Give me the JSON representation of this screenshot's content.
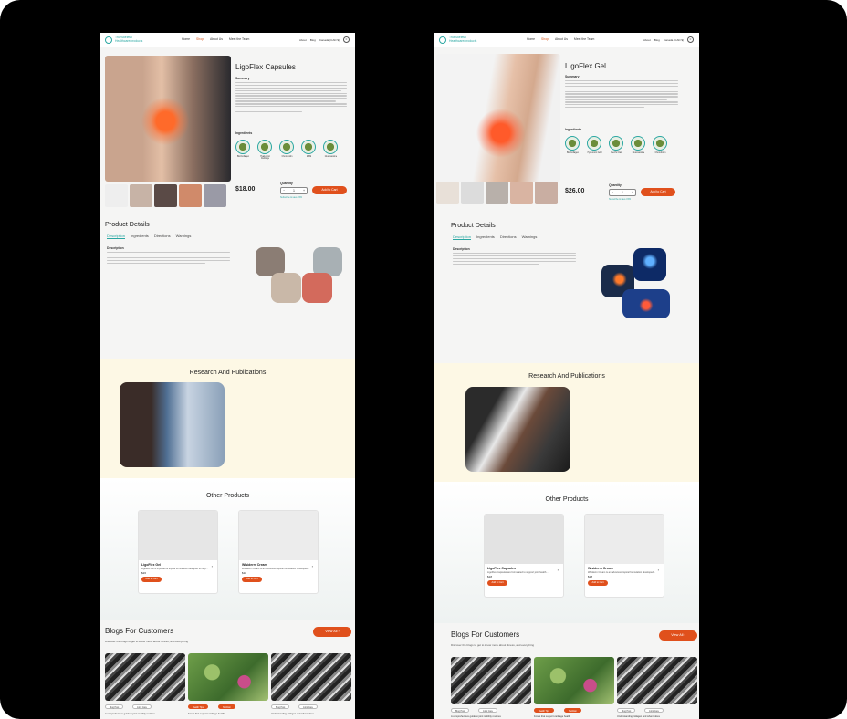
{
  "brand": {
    "name": "TrueSkeletal Healthcare/products"
  },
  "nav": {
    "links": [
      "Home",
      "Shop",
      "About Us",
      "Meet the Team"
    ],
    "right": [
      "About",
      "Blog",
      "Canada (CAD $)"
    ],
    "cart_count": "0"
  },
  "page_a": {
    "title": "LigoFlex Capsules",
    "summary_label": "Summary",
    "ingredients_label": "Ingredients",
    "ingredients": [
      "Bio/Collagen",
      "Hyaluronic Cartilage",
      "Chondroitin",
      "MSM",
      "Glucosamine"
    ],
    "price": "$18.00",
    "quantity_label": "Quantity",
    "quantity": "1",
    "add_to_cart": "Add to Cart",
    "subscribe_note": "Subscribe & save 15%",
    "details_title": "Product Details",
    "tabs": [
      "Description",
      "Ingredients",
      "Directions",
      "Warnings"
    ],
    "description_label": "Description",
    "research_title": "Research And Publications",
    "others_title": "Other Products",
    "others": [
      {
        "name": "LigoFlex Gel",
        "desc": "Ligoflex Gel is a powerful topical formulation designed to help...",
        "price": "$26",
        "cta": "Add to Cart"
      },
      {
        "name": "Wisiderm Cream",
        "desc": "Wisiderm Cream is an advanced topical formulation developed...",
        "price": "$18",
        "cta": "Add to Cart"
      }
    ],
    "blogs_title": "Blogs For Customers",
    "blogs_sub": "Discover the blogs to get to know more about fitness, and everything",
    "view_all": "View All",
    "blog_tags": [
      [
        "Blog Post",
        "Joint Care"
      ],
      [
        "Health Tips",
        "Nutrition"
      ],
      [
        "Blog Post",
        "Joint Care"
      ]
    ],
    "blog_texts": [
      "A comprehensive guide to joint mobility routines",
      "Foods that support cartilage health",
      "Understanding collagen and what it does"
    ]
  },
  "page_b": {
    "title": "LigoFlex Gel",
    "summary_label": "Summary",
    "ingredients_label": "Ingredients",
    "ingredients": [
      "Bio/Collagen",
      "Hyaluronic Acid",
      "Devil's Claw",
      "Glucosamine",
      "Chondroitin"
    ],
    "price": "$26.00",
    "quantity_label": "Quantity",
    "quantity": "1",
    "add_to_cart": "Add to Cart",
    "subscribe_note": "Subscribe & save 15%",
    "details_title": "Product Details",
    "tabs": [
      "Description",
      "Ingredients",
      "Directions",
      "Warnings"
    ],
    "description_label": "Description",
    "research_title": "Research And Publications",
    "others_title": "Other Products",
    "others": [
      {
        "name": "LigoFlex Capsules",
        "desc": "LigoFlex Capsules are formulated to support joint health...",
        "price": "$18",
        "cta": "Add to Cart"
      },
      {
        "name": "Wisiderm Cream",
        "desc": "Wisiderm Cream is an advanced topical formulation developed...",
        "price": "$18",
        "cta": "Add to Cart"
      }
    ],
    "blogs_title": "Blogs For Customers",
    "blogs_sub": "Discover the blogs to get to know more about fitness, and everything",
    "view_all": "View All",
    "blog_tags": [
      [
        "Blog Post",
        "Joint Care"
      ],
      [
        "Health Tips",
        "Nutrition"
      ],
      [
        "Blog Post",
        "Joint Care"
      ]
    ],
    "blog_texts": [
      "A comprehensive guide to joint mobility routines",
      "Foods that support cartilage health",
      "Understanding collagen and what it does"
    ]
  },
  "colors": {
    "accent": "#e0501c",
    "teal": "#2aa7a2",
    "research_bg": "#fdf8e5"
  }
}
